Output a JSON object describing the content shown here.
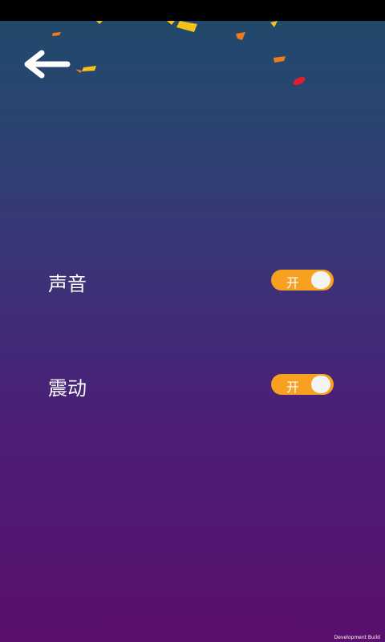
{
  "header": {
    "back_icon": "arrow-left-icon"
  },
  "settings": [
    {
      "label": "声音",
      "toggle_text": "开",
      "state": "on"
    },
    {
      "label": "震动",
      "toggle_text": "开",
      "state": "on"
    }
  ],
  "footer": {
    "build_label": "Development Build"
  },
  "colors": {
    "toggle_on": "#f8a020",
    "knob": "#f4f4f4",
    "text": "#ffffff",
    "bg_top": "#1f4a6b",
    "bg_bottom": "#5a0f6c",
    "confetti": [
      "#f6c21a",
      "#f07a1c",
      "#e01e2c"
    ]
  }
}
